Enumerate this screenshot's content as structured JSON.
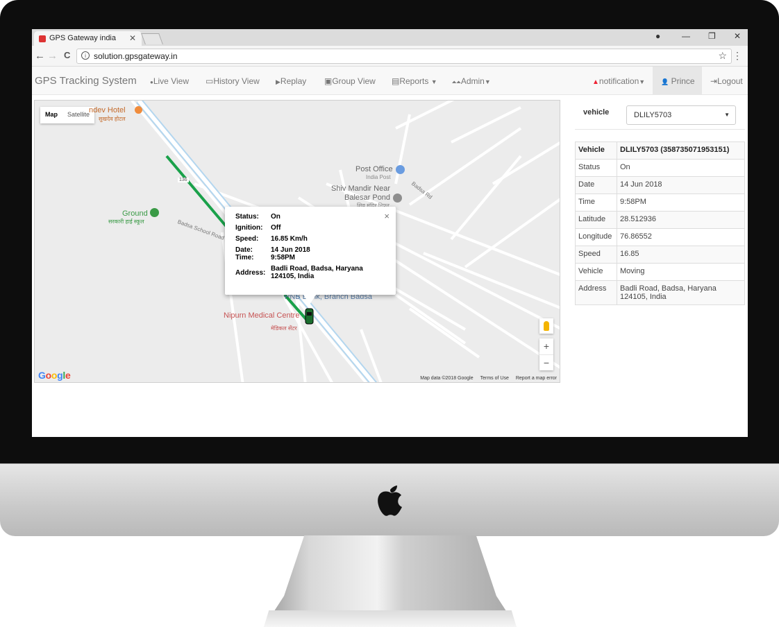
{
  "browser": {
    "tab_title": "GPS Gateway india",
    "tab_close": "✕",
    "url": "solution.gpsgateway.in",
    "back": "←",
    "forward": "→",
    "reload": "C",
    "star": "☆",
    "menu": "⋮",
    "win_profile": "●",
    "win_min": "—",
    "win_restore": "❐",
    "win_close": "✕"
  },
  "navbar": {
    "brand": "GPS Tracking System",
    "items": [
      {
        "label": "Live View",
        "icon": "map-marker-icon"
      },
      {
        "label": "History View",
        "icon": "map-icon"
      },
      {
        "label": "Replay",
        "icon": "play-circle-icon"
      },
      {
        "label": "Group View",
        "icon": "picture-icon"
      },
      {
        "label": "Reports",
        "icon": "table-icon"
      },
      {
        "label": "Admin",
        "icon": "road-icon"
      }
    ],
    "notification": "notification",
    "user": "Prince",
    "logout": "Logout",
    "icons": {
      "reports": "▤",
      "admin": "⏶⏶",
      "notification": "▲",
      "user": "👤",
      "logout": "⇥",
      "live": "●",
      "history": "▭",
      "replay": "▶",
      "group": "▣"
    }
  },
  "map": {
    "type_map": "Map",
    "type_satellite": "Satellite",
    "route_color": "#1aa14a",
    "pois": {
      "hotel": "ndev Hotel",
      "hotel_hi": "सुखदेव होटल",
      "post_office": "Post Office",
      "india_post": "India Post",
      "shiv_mandir_1": "Shiv Mandir Near",
      "shiv_mandir_2": "Balesar Pond",
      "shiv_mandir_hi": "शिव मंदिर निफर",
      "ground": "Ground",
      "ground_hi": "सरकारी हाई स्कूल",
      "school_road": "Badsa School Road",
      "badsa_rd": "Badsa Rd",
      "pnb": "PNB Bank, Branch Badsa",
      "nipurn": "Nipurn Medical Centre",
      "nipurn_hi": "मेडिकल सेंटर",
      "route_num": "136"
    },
    "popup": {
      "close": "×",
      "status_k": "Status:",
      "status_v": "On",
      "ignition_k": "Ignition:",
      "ignition_v": "Off",
      "speed_k": "Speed:",
      "speed_v": "16.85 Km/h",
      "date_k": "Date:",
      "date_v": "14 Jun 2018",
      "time_k": "Time:",
      "time_v": "9:58PM",
      "address_k": "Address:",
      "address_v": "Badli Road, Badsa, Haryana 124105, India"
    },
    "zoom_in": "+",
    "zoom_out": "−",
    "google": "Google",
    "attrib": [
      "Map data ©2018 Google",
      "Terms of Use",
      "Report a map error"
    ]
  },
  "panel": {
    "vehicle_label": "vehicle",
    "vehicle_selected": "DLILY5703",
    "caret": "▼",
    "rows": [
      {
        "k": "Vehicle",
        "v": "DLILY5703 (358735071953151)"
      },
      {
        "k": "Status",
        "v": "On"
      },
      {
        "k": "Date",
        "v": "14 Jun 2018"
      },
      {
        "k": "Time",
        "v": "9:58PM"
      },
      {
        "k": "Latitude",
        "v": "28.512936"
      },
      {
        "k": "Longitude",
        "v": "76.86552"
      },
      {
        "k": "Speed",
        "v": "16.85"
      },
      {
        "k": "Vehicle",
        "v": "Moving"
      },
      {
        "k": "Address",
        "v": "Badli Road, Badsa, Haryana 124105, India"
      }
    ]
  }
}
